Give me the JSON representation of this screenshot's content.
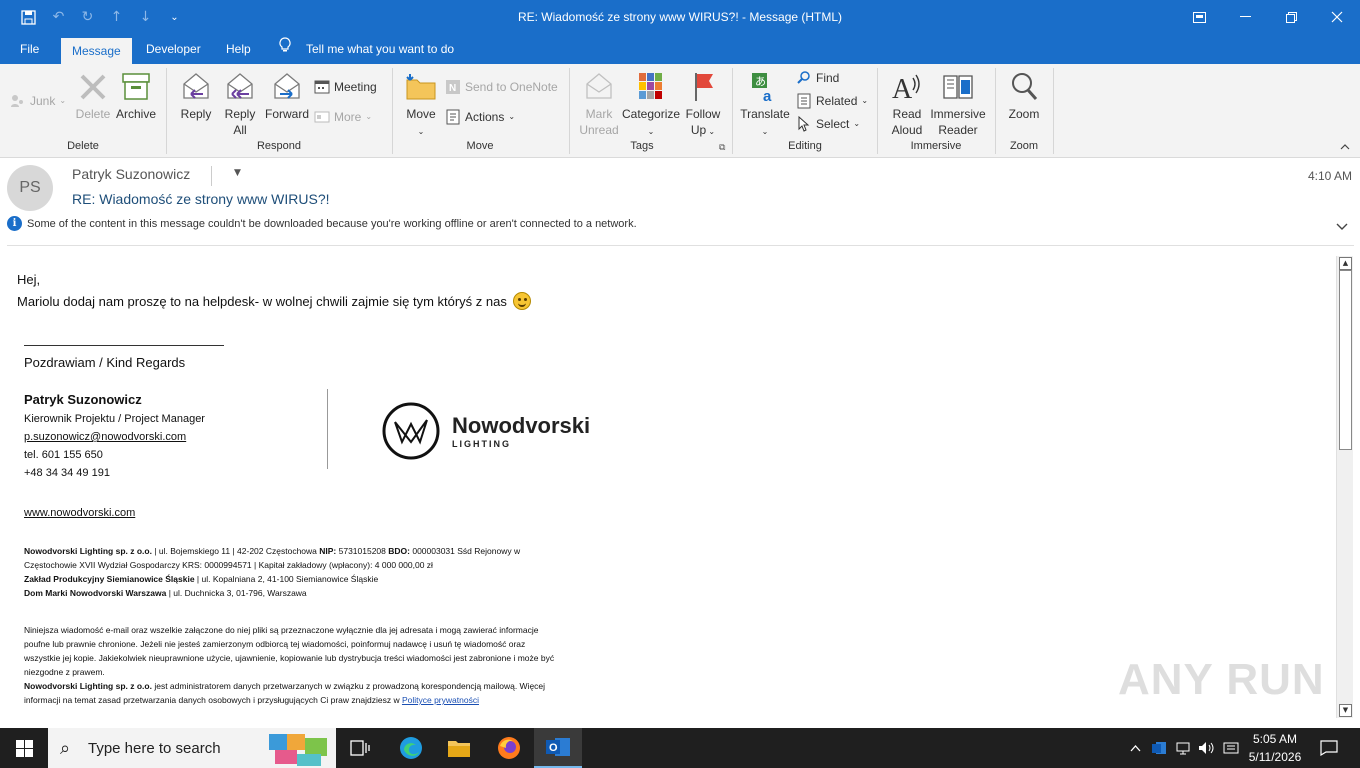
{
  "window": {
    "title": "RE: Wiadomość ze strony www WIRUS?!  -  Message (HTML)",
    "accent": "#1a6ec9"
  },
  "tabs": [
    "File",
    "Message",
    "Developer",
    "Help"
  ],
  "tell_me": "Tell me what you want to do",
  "ribbon": {
    "delete_group": {
      "label": "Delete",
      "junk": "Junk",
      "delete": "Delete",
      "archive": "Archive"
    },
    "respond_group": {
      "label": "Respond",
      "reply": "Reply",
      "reply_all_1": "Reply",
      "reply_all_2": "All",
      "forward": "Forward",
      "meeting": "Meeting",
      "more": "More"
    },
    "move_group": {
      "label": "Move",
      "move": "Move",
      "send_onenote": "Send to OneNote",
      "actions": "Actions"
    },
    "tags_group": {
      "label": "Tags",
      "mark_unread_1": "Mark",
      "mark_unread_2": "Unread",
      "categorize": "Categorize",
      "follow_up_1": "Follow",
      "follow_up_2": "Up"
    },
    "editing_group": {
      "label": "Editing",
      "translate": "Translate",
      "find": "Find",
      "related": "Related",
      "select": "Select"
    },
    "immersive_group": {
      "label": "Immersive",
      "read_aloud_1": "Read",
      "read_aloud_2": "Aloud",
      "immersive_reader_1": "Immersive",
      "immersive_reader_2": "Reader"
    },
    "zoom_group": {
      "label": "Zoom",
      "zoom": "Zoom"
    }
  },
  "message": {
    "avatar_initials": "PS",
    "sender": "Patryk Suzonowicz",
    "subject": "RE: Wiadomość ze strony www WIRUS?!",
    "time": "4:10 AM",
    "info": "Some of the content in this message couldn't be downloaded because you're working offline or aren't connected to a network.",
    "greeting": "Hej,",
    "body_line": "Mariolu dodaj nam proszę to na helpdesk- w wolnej chwili zajmie się tym któryś z nas"
  },
  "signature": {
    "regards": "Pozdrawiam / Kind Regards",
    "name": "Patryk Suzonowicz",
    "role": "Kierownik Projektu / Project Manager",
    "email": "p.suzonowicz@nowodvorski.com",
    "tel1": "tel. 601 155 650",
    "tel2": "+48 34 34 49 191",
    "website": "www.nowodvorski.com",
    "logo_name": "Nowodvorski",
    "logo_sub": "LIGHTING"
  },
  "legal": {
    "company_bold": "Nowodvorski Lighting sp. z o.o.",
    "company_text_a": " | ul. Bojemskiego 11 | 42-202 Częstochowa ",
    "nip_label": "NIP:",
    "nip_value": " 5731015208 ",
    "bdo_label": "BDO:",
    "bdo_value": " 000003031 Sśd Rejonowy w",
    "company_text_b": "Częstochowie XVII Wydział Gospodarczy KRS: 0000994571 | Kapitał zakładowy (wpłacony): 4 000 000,00 zł",
    "plant_bold": "Zakład Produkcyjny Siemianowice Śląskie",
    "plant_text": " | ul. Kopalniana 2, 41-100 Siemianowice Śląskie",
    "brand_bold": "Dom Marki Nowodvorski Warszawa",
    "brand_text": " | ul. Duchnicka 3, 01-796, Warszawa",
    "conf_1": "Niniejsza wiadomość e-mail oraz wszelkie załączone do niej pliki są przeznaczone wyłącznie dla jej adresata i mogą zawierać informacje",
    "conf_2": "poufne lub prawnie chronione. Jeżeli nie jesteś zamierzonym odbiorcą tej wiadomości, poinformuj nadawcę i usuń tę wiadomość oraz",
    "conf_3": "wszystkie jej kopie. Jakiekolwiek nieuprawnione użycie, ujawnienie, kopiowanie lub dystrybucja treści wiadomości jest zabronione i może być",
    "conf_4": "niezgodne z prawem.",
    "admin_bold": "Nowodvorski Lighting sp. z o.o.",
    "admin_text": " jest administratorem danych przetwarzanych w związku z prowadzoną korespondencją mailową. Więcej",
    "admin_2": "informacji na temat zasad przetwarzania danych osobowych i przysługujących Ci praw znajdziesz w ",
    "policy_link": "Polityce prywatności"
  },
  "watermark": "ANY RUN",
  "taskbar": {
    "search_placeholder": "Type here to search",
    "time": "5:05 AM",
    "date": "5/11/2026"
  }
}
